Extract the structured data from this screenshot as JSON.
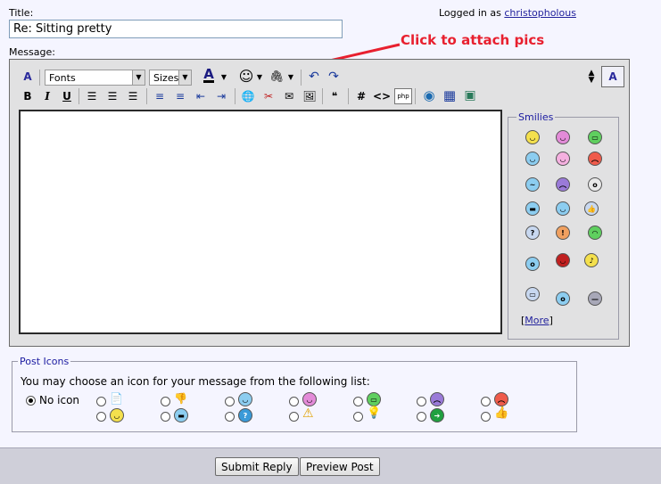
{
  "labels": {
    "title": "Title:",
    "message": "Message:"
  },
  "login": {
    "prefix": "Logged in as",
    "user": "christopholous"
  },
  "title_field": {
    "value": "Re: Sitting pretty"
  },
  "annotation": {
    "text": "Click to attach pics"
  },
  "toolbar": {
    "font_select": "Fonts",
    "size_select": "Sizes",
    "bold": "B",
    "italic": "I",
    "underline": "U",
    "hash": "#",
    "code": "<>",
    "php": "php"
  },
  "smilies": {
    "legend": "Smilies",
    "more_open": "[",
    "more_link": "More",
    "more_close": "]"
  },
  "post_icons": {
    "legend": "Post Icons",
    "prompt": "You may choose an icon for your message from the following list:",
    "no_icon": "No icon",
    "selected": "no-icon"
  },
  "buttons": {
    "submit": "Submit Reply",
    "preview": "Preview Post"
  },
  "colors": {
    "callout_red": "#e8202f",
    "link_blue": "#22229c",
    "smiley_yellow": "#f4e04d"
  }
}
